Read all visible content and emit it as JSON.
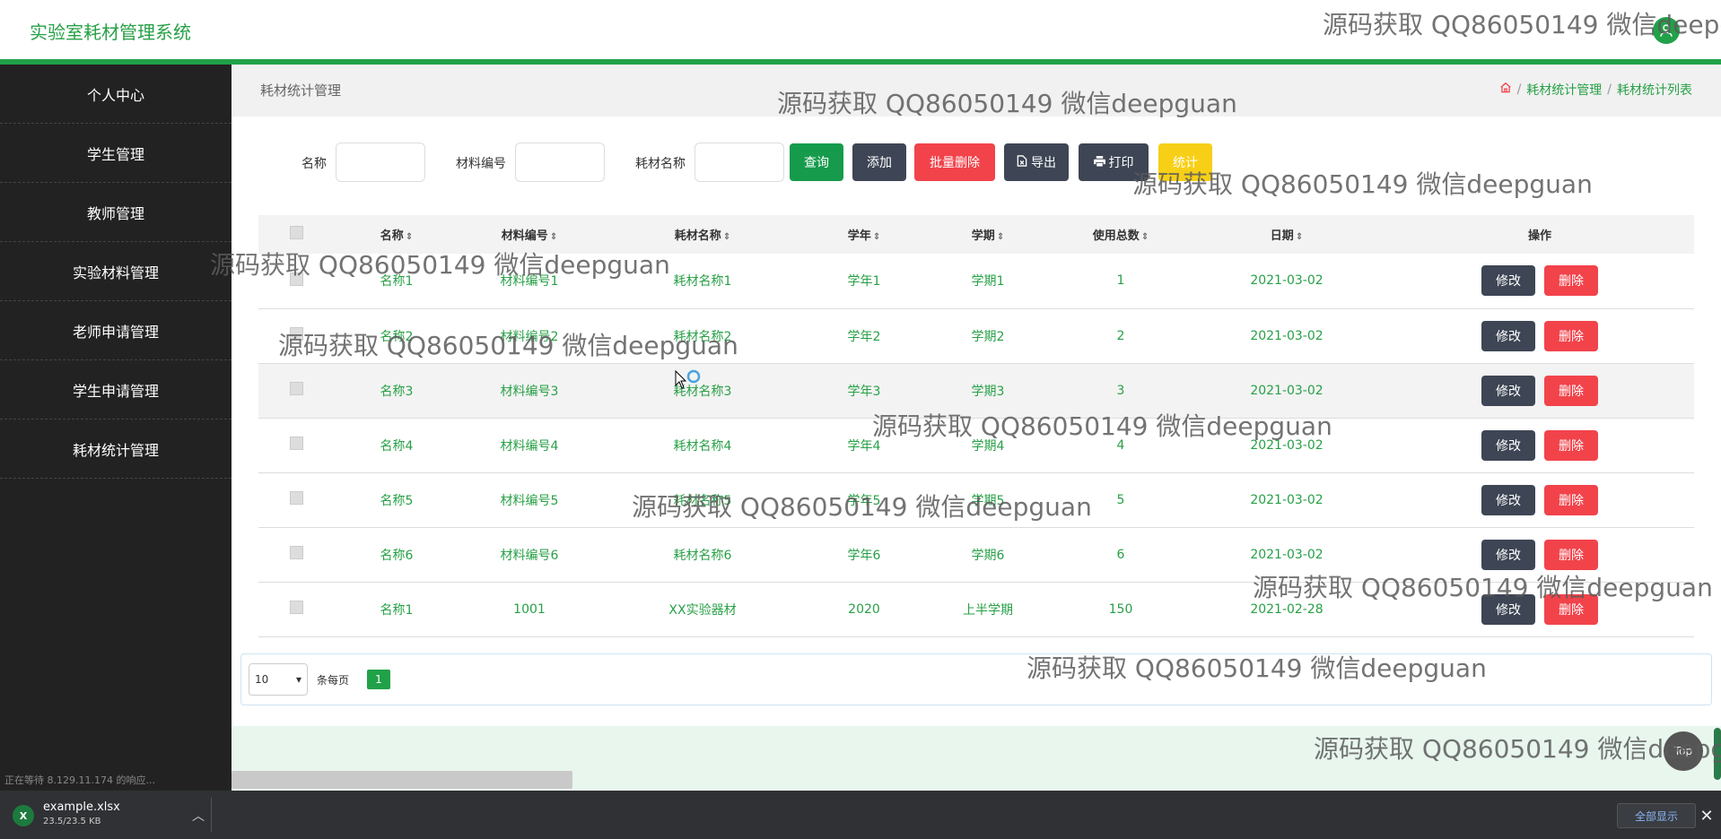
{
  "app": {
    "title": "实验室耗材管理系统"
  },
  "sidebar": {
    "items": [
      {
        "label": "个人中心"
      },
      {
        "label": "学生管理"
      },
      {
        "label": "教师管理"
      },
      {
        "label": "实验材料管理"
      },
      {
        "label": "老师申请管理"
      },
      {
        "label": "学生申请管理"
      },
      {
        "label": "耗材统计管理"
      }
    ]
  },
  "breadcrumb": {
    "title": "耗材统计管理",
    "items": [
      "耗材统计管理",
      "耗材统计列表"
    ],
    "separator": "/"
  },
  "search": {
    "name_label": "名称",
    "code_label": "材料编号",
    "material_label": "耗材名称",
    "query_button": "查询",
    "add_button": "添加",
    "batch_delete_button": "批量删除",
    "export_button": "导出",
    "print_button": "打印",
    "stats_button": "统计"
  },
  "table": {
    "columns": [
      "名称",
      "材料编号",
      "耗材名称",
      "学年",
      "学期",
      "使用总数",
      "日期",
      "操作"
    ],
    "edit_label": "修改",
    "delete_label": "删除",
    "rows": [
      {
        "name": "名称1",
        "code": "材料编号1",
        "material": "耗材名称1",
        "year": "学年1",
        "term": "学期1",
        "total": "1",
        "date": "2021-03-02"
      },
      {
        "name": "名称2",
        "code": "材料编号2",
        "material": "耗材名称2",
        "year": "学年2",
        "term": "学期2",
        "total": "2",
        "date": "2021-03-02"
      },
      {
        "name": "名称3",
        "code": "材料编号3",
        "material": "耗材名称3",
        "year": "学年3",
        "term": "学期3",
        "total": "3",
        "date": "2021-03-02"
      },
      {
        "name": "名称4",
        "code": "材料编号4",
        "material": "耗材名称4",
        "year": "学年4",
        "term": "学期4",
        "total": "4",
        "date": "2021-03-02"
      },
      {
        "name": "名称5",
        "code": "材料编号5",
        "material": "耗材名称5",
        "year": "学年5",
        "term": "学期5",
        "total": "5",
        "date": "2021-03-02"
      },
      {
        "name": "名称6",
        "code": "材料编号6",
        "material": "耗材名称6",
        "year": "学年6",
        "term": "学期6",
        "total": "6",
        "date": "2021-03-02"
      },
      {
        "name": "名称1",
        "code": "1001",
        "material": "XX实验器材",
        "year": "2020",
        "term": "上半学期",
        "total": "150",
        "date": "2021-02-28"
      }
    ]
  },
  "pagination": {
    "page_size": "10",
    "per_page_label": "条每页",
    "current_page": "1"
  },
  "scroll_top": {
    "label": "Top"
  },
  "status_bar": {
    "text": "正在等待 8.129.11.174 的响应..."
  },
  "download": {
    "file_name": "example.xlsx",
    "file_size": "23.5/23.5 KB",
    "show_all": "全部显示",
    "close": "✕"
  },
  "watermark": {
    "text": "源码获取 QQ86050149 微信deepguan"
  },
  "colors": {
    "accent": "#21a148",
    "sidebar_bg": "#222222",
    "dark_button": "#3e4655",
    "danger": "#f2434b",
    "warning": "#f7cf16",
    "text_green": "#27a046"
  }
}
